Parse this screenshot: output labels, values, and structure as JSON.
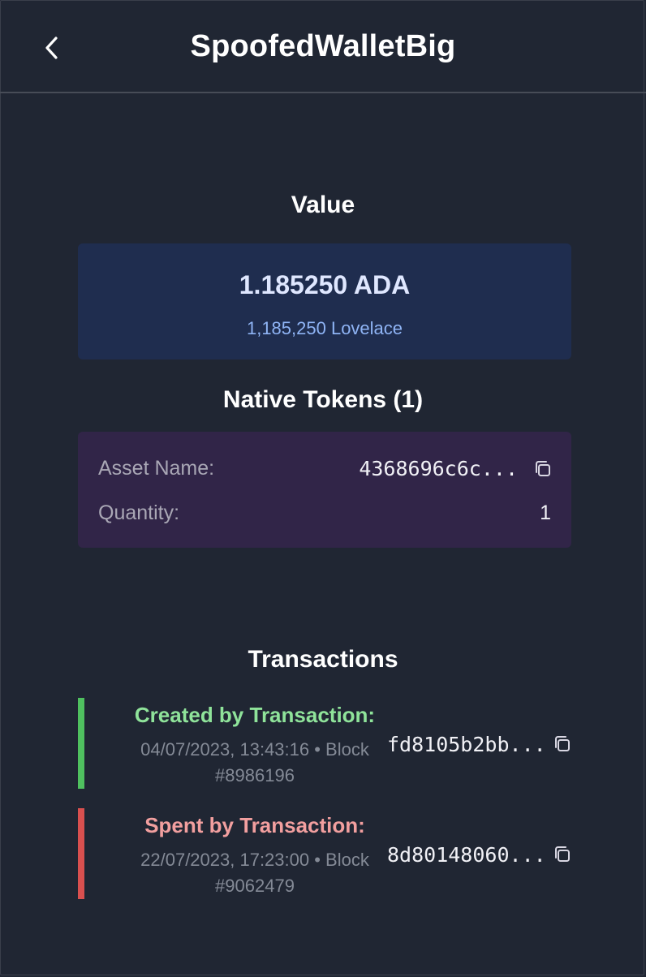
{
  "header": {
    "title": "SpoofedWalletBig",
    "back_icon": "chevron-left-icon"
  },
  "value_section": {
    "heading": "Value",
    "ada": "1.185250 ADA",
    "lovelace": "1,185,250 Lovelace"
  },
  "native_tokens": {
    "heading": "Native Tokens (1)",
    "asset_name_label": "Asset Name:",
    "asset_name_value": "4368696c6c...",
    "quantity_label": "Quantity:",
    "quantity_value": "1",
    "copy_icon": "copy-icon"
  },
  "transactions": {
    "heading": "Transactions",
    "items": [
      {
        "title": "Created by Transaction:",
        "datetime_block": "04/07/2023, 13:43:16 • Block",
        "block_number": "#8986196",
        "hash": "fd8105b2bb...",
        "status_color": "#4fc05f",
        "title_color": "#8fe39a"
      },
      {
        "title": "Spent by Transaction:",
        "datetime_block": "22/07/2023, 17:23:00 • Block",
        "block_number": "#9062479",
        "hash": "8d80148060...",
        "status_color": "#d9504f",
        "title_color": "#f29f9f"
      }
    ]
  },
  "colors": {
    "background": "#202633",
    "value_card": "#1f2d4f",
    "tokens_card": "#312548"
  }
}
